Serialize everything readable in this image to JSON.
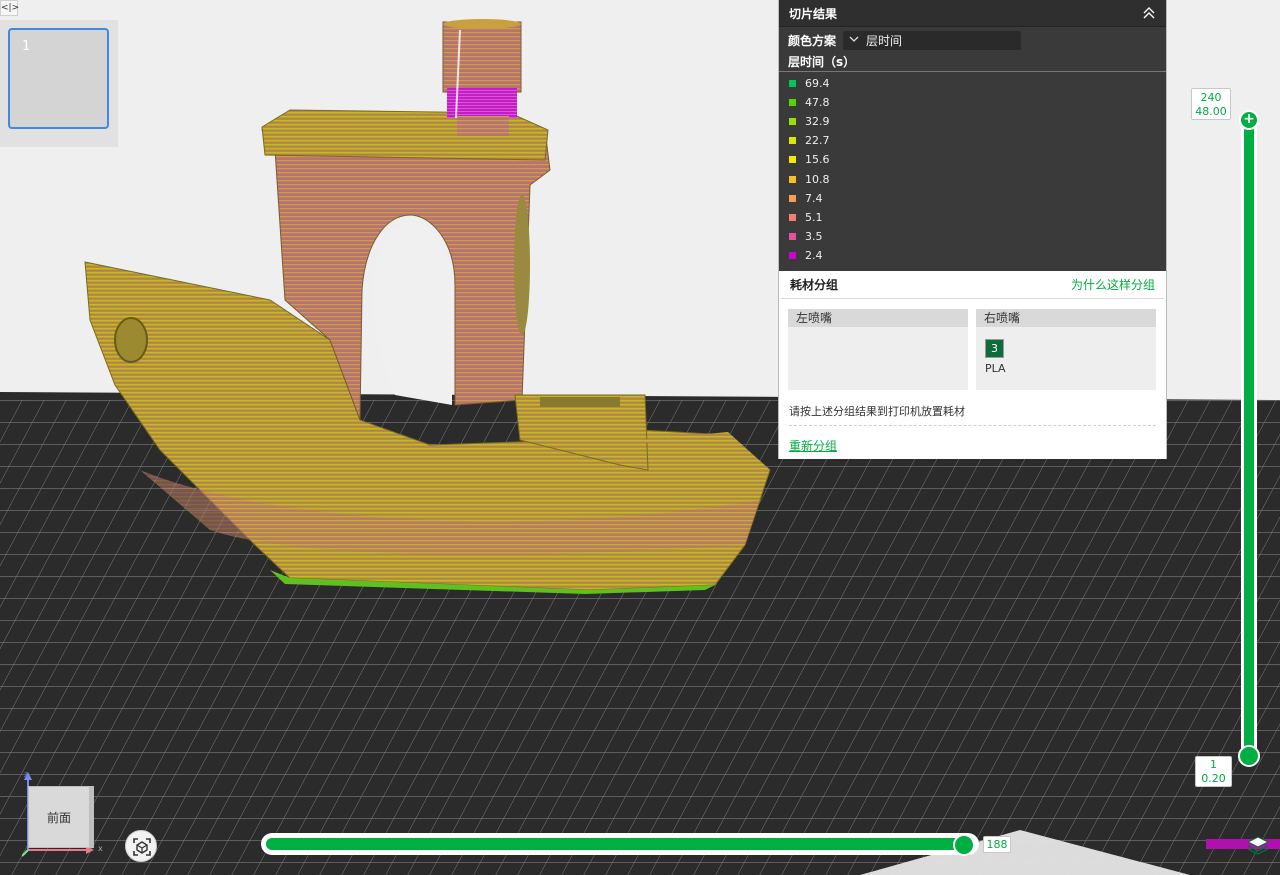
{
  "sidebar": {
    "toggle_label": "<|>",
    "plate_number": "1"
  },
  "slice_panel": {
    "title": "切片结果",
    "color_scheme_label": "颜色方案",
    "color_scheme_value": "层时间",
    "legend_title": "层时间（s）",
    "legend": [
      {
        "value": "69.4",
        "color": "#00c853"
      },
      {
        "value": "47.8",
        "color": "#55d400"
      },
      {
        "value": "32.9",
        "color": "#9be000"
      },
      {
        "value": "22.7",
        "color": "#d6ea00"
      },
      {
        "value": "15.6",
        "color": "#f4e800"
      },
      {
        "value": "10.8",
        "color": "#f5c020"
      },
      {
        "value": "7.4",
        "color": "#f5a050"
      },
      {
        "value": "5.1",
        "color": "#f08070"
      },
      {
        "value": "3.5",
        "color": "#ea50a0"
      },
      {
        "value": "2.4",
        "color": "#d000d0"
      }
    ]
  },
  "filament": {
    "title": "耗材分组",
    "why_link": "为什么这样分组",
    "left_nozzle": "左喷嘴",
    "right_nozzle": "右喷嘴",
    "filament_slot": "3",
    "filament_type": "PLA",
    "note": "请按上述分组结果到打印机放置耗材",
    "regroup": "重新分组"
  },
  "layer_slider": {
    "top_layer": "240",
    "top_height": "48.00",
    "top_plus": "+",
    "bottom_layer": "1",
    "bottom_height": "0.20"
  },
  "move_slider": {
    "value": "188"
  },
  "view_cube": {
    "face_label": "前面",
    "axis_z": "z",
    "axis_x": "x"
  },
  "colors": {
    "accent": "#00ae42",
    "panel_dark": "#3a3a3a",
    "bed_dark": "#2a2a2a"
  }
}
